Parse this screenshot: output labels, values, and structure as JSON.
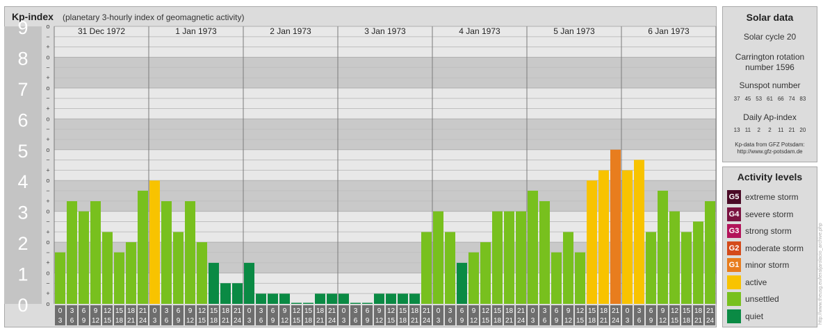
{
  "header": {
    "title": "Kp-index",
    "subtitle": "(planetary 3-hourly index of geomagnetic activity)"
  },
  "chart_data": {
    "type": "bar",
    "title": "Kp-index",
    "subtitle": "(planetary 3-hourly index of geomagnetic activity)",
    "ylim": [
      0,
      9
    ],
    "y_ticks": [
      "0",
      "1",
      "2",
      "3",
      "4",
      "5",
      "6",
      "7",
      "8",
      "9"
    ],
    "minor_ticks": [
      "o",
      "+",
      "−"
    ],
    "days": [
      "31 Dec 1972",
      "1 Jan 1973",
      "2 Jan 1973",
      "3 Jan 1973",
      "4 Jan 1973",
      "5 Jan 1973",
      "6 Jan 1973"
    ],
    "interval_top": [
      "0",
      "3",
      "6",
      "9",
      "12",
      "15",
      "18",
      "21"
    ],
    "interval_bottom": [
      "3",
      "6",
      "9",
      "12",
      "15",
      "18",
      "21",
      "24"
    ],
    "values": [
      [
        1.67,
        3.33,
        3.0,
        3.33,
        2.33,
        1.67,
        2.0,
        3.67
      ],
      [
        4.0,
        3.33,
        2.33,
        3.33,
        2.0,
        1.33,
        0.67,
        0.67
      ],
      [
        1.33,
        0.33,
        0.33,
        0.33,
        0.0,
        0.0,
        0.33,
        0.33
      ],
      [
        0.33,
        0.0,
        0.0,
        0.33,
        0.33,
        0.33,
        0.33,
        2.33
      ],
      [
        3.0,
        2.33,
        1.33,
        1.67,
        2.0,
        3.0,
        3.0,
        3.0
      ],
      [
        3.67,
        3.33,
        1.67,
        2.33,
        1.67,
        4.0,
        4.33,
        5.0
      ],
      [
        4.33,
        4.67,
        2.33,
        3.67,
        3.0,
        2.33,
        2.67,
        3.33
      ]
    ],
    "colors": {
      "quiet": "#0a8a44",
      "unsettled": "#78c01e",
      "active": "#f8c300",
      "G1": "#e87d1e",
      "G2": "#d44a1a",
      "G3": "#b3145a",
      "G4": "#7a1240",
      "G5": "#4a0a26"
    },
    "grid": true
  },
  "solar_data": {
    "title": "Solar data",
    "solar_cycle": "Solar cycle 20",
    "carrington_line1": "Carrington rotation",
    "carrington_line2": "number 1596",
    "sunspot_title": "Sunspot number",
    "sunspot_numbers": [
      "37",
      "45",
      "53",
      "61",
      "66",
      "74",
      "83"
    ],
    "ap_title": "Daily Ap-index",
    "ap_values": [
      "13",
      "11",
      "2",
      "2",
      "11",
      "21",
      "20"
    ],
    "source_line1": "Kp-data from GFZ Potsdam:",
    "source_line2": "http://www.gfz-potsdam.de"
  },
  "activity_levels": {
    "title": "Activity levels",
    "items": [
      {
        "code": "G5",
        "label": "extreme storm",
        "color": "#4a0a26"
      },
      {
        "code": "G4",
        "label": "severe storm",
        "color": "#7a1240"
      },
      {
        "code": "G3",
        "label": "strong storm",
        "color": "#b3145a"
      },
      {
        "code": "G2",
        "label": "moderate storm",
        "color": "#d44a1a"
      },
      {
        "code": "G1",
        "label": "minor storm",
        "color": "#e87d1e"
      },
      {
        "code": "",
        "label": "active",
        "color": "#f8c300"
      },
      {
        "code": "",
        "label": "unsettled",
        "color": "#78c01e"
      },
      {
        "code": "",
        "label": "quiet",
        "color": "#0a8a44"
      }
    ]
  },
  "credit": "http://www.theusg.eu/teraljarolacio_archive.php"
}
